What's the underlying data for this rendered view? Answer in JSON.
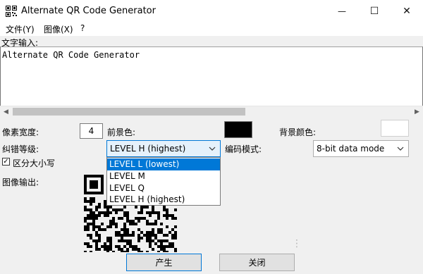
{
  "window": {
    "title": "Alternate QR Code Generator",
    "app_icon": "qr-icon",
    "controls": {
      "minimize": "—",
      "maximize": "☐",
      "close": "✕"
    }
  },
  "menu": {
    "items": [
      {
        "label": "文件(Y)"
      },
      {
        "label": "图像(X)"
      },
      {
        "label": "?"
      }
    ]
  },
  "text_input": {
    "label": "文字输入:",
    "value": "Alternate QR Code Generator"
  },
  "settings": {
    "pixel_width_label": "像素宽度:",
    "pixel_width_value": "4",
    "foreground_label": "前景色:",
    "foreground_color": "#000000",
    "background_label": "背景颜色:",
    "background_color": "#ffffff",
    "error_correction_label": "纠错等级:",
    "error_correction_selected": "LEVEL H (highest)",
    "error_correction_options": [
      "LEVEL L (lowest)",
      "LEVEL M",
      "LEVEL Q",
      "LEVEL H (highest)"
    ],
    "encoding_mode_label": "编码模式:",
    "encoding_mode_selected": "8-bit data mode",
    "case_sensitive_label": "区分大小写",
    "case_sensitive_checked": true
  },
  "output": {
    "label": "图像输出:"
  },
  "buttons": {
    "generate": "产生",
    "close": "关闭"
  },
  "colors": {
    "accent": "#0078d7",
    "selection_text": "#ffffff"
  }
}
